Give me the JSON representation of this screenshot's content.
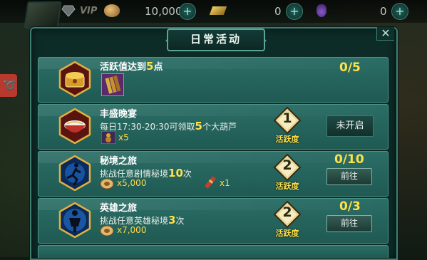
{
  "topbar": {
    "vip": "VIP",
    "silver_value": "10,000",
    "gold_value": "0",
    "potion_value": "0",
    "plus": "+"
  },
  "dialog": {
    "title": "日常活动",
    "close": "✕"
  },
  "activities": [
    {
      "title_prefix": "活跃值达到",
      "title_num": "5",
      "title_suffix": "点",
      "progress": "0/5"
    },
    {
      "title": "丰盛晚宴",
      "desc_prefix": "每日17:30-20:30可领取",
      "desc_num": "5",
      "desc_suffix": "个大葫芦",
      "reward": "x5",
      "badge_num": "1",
      "badge_label": "活跃度",
      "button": "未开启"
    },
    {
      "title": "秘境之旅",
      "desc_prefix": "挑战任意剧情秘境",
      "desc_num": "10",
      "desc_suffix": "次",
      "reward1": "x5,000",
      "reward2": "x1",
      "badge_num": "2",
      "badge_label": "活跃度",
      "progress": "0/10",
      "button": "前往"
    },
    {
      "title": "英雄之旅",
      "desc_prefix": "挑战任意英雄秘境",
      "desc_num": "3",
      "desc_suffix": "次",
      "reward1": "x7,000",
      "badge_num": "2",
      "badge_label": "活跃度",
      "progress": "0/3",
      "button": "前往"
    }
  ]
}
